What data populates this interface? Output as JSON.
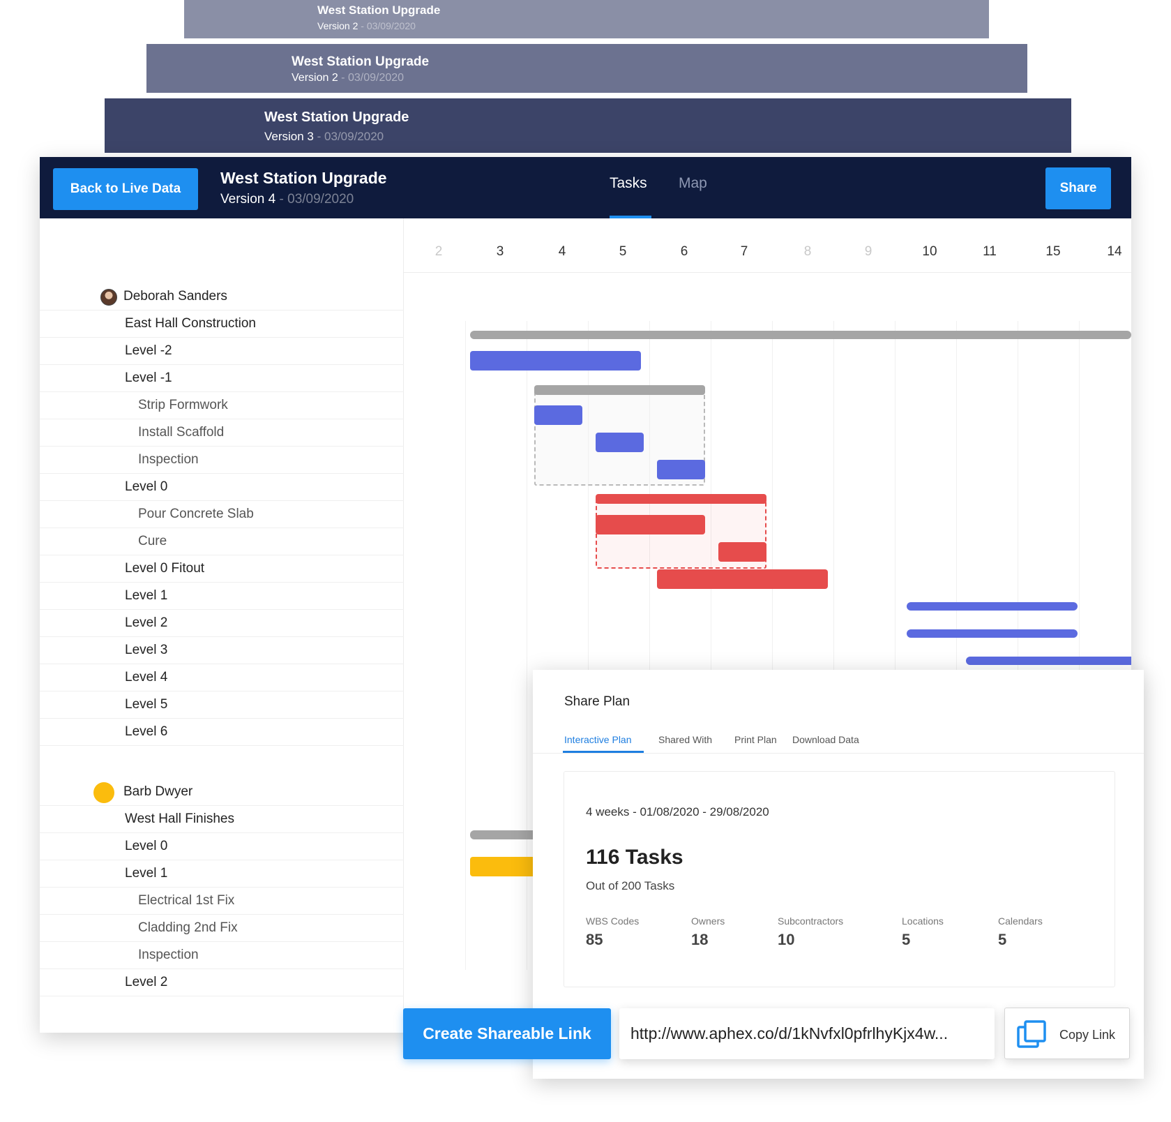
{
  "versions": [
    {
      "title": "West Station Upgrade",
      "version": "Version 2",
      "date": "03/09/2020"
    },
    {
      "title": "West Station Upgrade",
      "version": "Version 2",
      "date": "03/09/2020"
    },
    {
      "title": "West Station Upgrade",
      "version": "Version 3",
      "date": "03/09/2020"
    }
  ],
  "header": {
    "back_label": "Back to Live Data",
    "title": "West Station Upgrade",
    "version": "Version 4",
    "date": "03/09/2020",
    "separator": "-",
    "tabs": [
      {
        "label": "Tasks",
        "active": true
      },
      {
        "label": "Map",
        "active": false
      }
    ],
    "share_label": "Share"
  },
  "timeline": {
    "days": [
      {
        "label": "2",
        "weekend": true
      },
      {
        "label": "3",
        "weekend": false
      },
      {
        "label": "4",
        "weekend": false
      },
      {
        "label": "5",
        "weekend": false
      },
      {
        "label": "6",
        "weekend": false
      },
      {
        "label": "7",
        "weekend": false
      },
      {
        "label": "8",
        "weekend": true
      },
      {
        "label": "9",
        "weekend": true
      },
      {
        "label": "10",
        "weekend": false
      },
      {
        "label": "11",
        "weekend": false
      },
      {
        "label": "15",
        "weekend": false
      },
      {
        "label": "14",
        "weekend": false
      }
    ]
  },
  "tasks": {
    "owner_1": "Deborah Sanders",
    "group_1": [
      {
        "label": "East Hall Construction",
        "level": 1
      },
      {
        "label": "Level -2",
        "level": 1
      },
      {
        "label": "Level -1",
        "level": 1
      },
      {
        "label": "Strip Formwork",
        "level": 2
      },
      {
        "label": "Install Scaffold",
        "level": 2
      },
      {
        "label": "Inspection",
        "level": 2
      },
      {
        "label": "Level 0",
        "level": 1
      },
      {
        "label": "Pour Concrete Slab",
        "level": 2
      },
      {
        "label": "Cure",
        "level": 2
      },
      {
        "label": "Level 0 Fitout",
        "level": 1
      },
      {
        "label": "Level 1",
        "level": 1
      },
      {
        "label": "Level 2",
        "level": 1
      },
      {
        "label": "Level 3",
        "level": 1
      },
      {
        "label": "Level 4",
        "level": 1
      },
      {
        "label": "Level 5",
        "level": 1
      },
      {
        "label": "Level 6",
        "level": 1
      }
    ],
    "owner_2": "Barb Dwyer",
    "group_2": [
      {
        "label": "West Hall Finishes",
        "level": 1
      },
      {
        "label": "Level 0",
        "level": 1
      },
      {
        "label": "Level 1",
        "level": 1
      },
      {
        "label": "Electrical 1st Fix",
        "level": 2
      },
      {
        "label": "Cladding 2nd Fix",
        "level": 2
      },
      {
        "label": "Inspection",
        "level": 2
      },
      {
        "label": "Level 2",
        "level": 1
      }
    ]
  },
  "colors": {
    "accent": "#1e8ff0",
    "navy": "#0f1b3d",
    "bar_blue": "#5b6ae0",
    "bar_red": "#e64c4c",
    "bar_gray": "#a5a5a5",
    "bar_yellow": "#fbbc0d"
  },
  "share_dialog": {
    "title": "Share Plan",
    "tabs": [
      "Interactive Plan",
      "Shared With",
      "Print Plan",
      "Download Data"
    ],
    "period": "4 weeks - 01/08/2020 - 29/08/2020",
    "task_count": "116 Tasks",
    "out_of": "Out of 200 Tasks",
    "stats": [
      {
        "label": "WBS Codes",
        "value": "85"
      },
      {
        "label": "Owners",
        "value": "18"
      },
      {
        "label": "Subcontractors",
        "value": "10"
      },
      {
        "label": "Locations",
        "value": "5"
      },
      {
        "label": "Calendars",
        "value": "5"
      }
    ],
    "create_label": "Create Shareable Link",
    "link_value": "http://www.aphex.co/d/1kNvfxl0pfrlhyKjx4w...",
    "copy_label": "Copy Link",
    "copy_icon": "copy-icon"
  }
}
